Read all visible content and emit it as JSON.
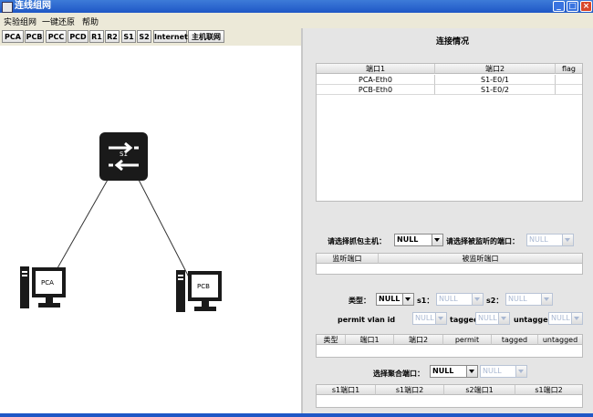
{
  "window": {
    "title": "连线组网"
  },
  "menu": [
    "实验组网",
    "一键还原",
    "帮助"
  ],
  "toolbar": [
    "PCA",
    "PCB",
    "PCC",
    "PCD",
    "R1",
    "R2",
    "S1",
    "S2",
    "Internet",
    "主机联网"
  ],
  "topology": {
    "switch_label": "S1",
    "hosts": [
      "PCA",
      "PCB"
    ]
  },
  "connections": {
    "title": "连接情况",
    "headers": [
      "端口1",
      "端口2",
      "flag"
    ],
    "rows": [
      [
        "PCA-Eth0",
        "S1-E0/1",
        ""
      ],
      [
        "PCB-Eth0",
        "S1-E0/2",
        ""
      ]
    ]
  },
  "capture": {
    "host_label": "请选择抓包主机：",
    "host_value": "NULL",
    "port_label": "请选择被监听的端口：",
    "port_value": "NULL",
    "headers": [
      "监听端口",
      "被监听端口"
    ]
  },
  "vlan": {
    "type_label": "类型：",
    "type_value": "NULL",
    "s1_label": "s1：",
    "s1_value": "NULL",
    "s2_label": "s2：",
    "s2_value": "NULL",
    "permit_label": "permit vlan id",
    "permit_value": "NULL",
    "tagged_label": "tagged",
    "tagged_value": "NULL",
    "untagged_label": "untagged",
    "untagged_value": "NULL",
    "headers": [
      "类型",
      "端口1",
      "端口2",
      "permit",
      "tagged",
      "untagged"
    ]
  },
  "aggregation": {
    "label": "选择聚合端口：",
    "value1": "NULL",
    "value2": "NULL",
    "headers": [
      "s1端口1",
      "s1端口2",
      "s2端口1",
      "s1端口2"
    ]
  },
  "colors": {
    "titlebar": "#1f57c6",
    "panel_bg": "#e5e5e5",
    "device_fill": "#1a1a1a"
  }
}
